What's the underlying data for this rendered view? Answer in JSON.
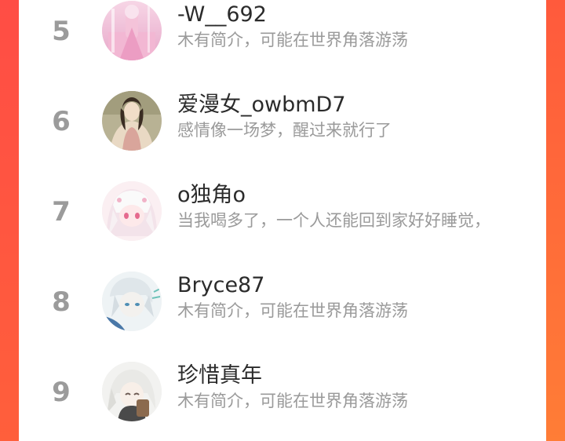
{
  "leaderboard": {
    "items": [
      {
        "rank": "5",
        "name": "-W__692",
        "bio": "木有简介，可能在世界角落游荡"
      },
      {
        "rank": "6",
        "name": "爱漫女_owbmD7",
        "bio": "感情像一场梦，醒过来就行了"
      },
      {
        "rank": "7",
        "name": "o独角o",
        "bio": "当我喝多了，一个人还能回到家好好睡觉，"
      },
      {
        "rank": "8",
        "name": "Bryce87",
        "bio": "木有简介，可能在世界角落游荡"
      },
      {
        "rank": "9",
        "name": "珍惜真年",
        "bio": "木有简介，可能在世界角落游荡"
      }
    ]
  },
  "colors": {
    "accent": "#ff6a3a",
    "rank_gray": "#9b9b9b",
    "name_color": "#2b2b2b",
    "bio_color": "#9a9a9a"
  }
}
